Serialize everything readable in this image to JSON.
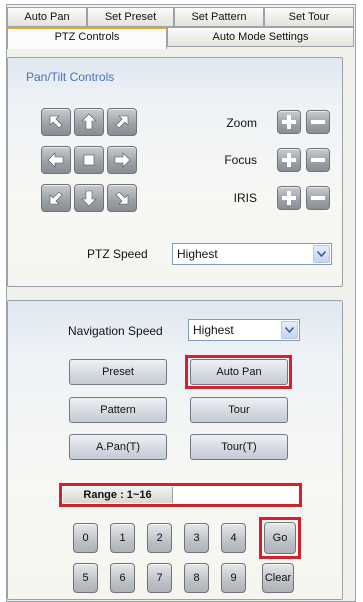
{
  "tabs_row1": [
    {
      "label": "Auto Pan"
    },
    {
      "label": "Set Preset"
    },
    {
      "label": "Set Pattern"
    },
    {
      "label": "Set Tour"
    }
  ],
  "tabs_row2": [
    {
      "label": "PTZ Controls",
      "active": true
    },
    {
      "label": "Auto Mode Settings",
      "active": false
    }
  ],
  "pan_tilt": {
    "title": "Pan/Tilt Controls",
    "arrows": [
      "up-left",
      "up",
      "up-right",
      "left",
      "stop",
      "right",
      "down-left",
      "down",
      "down-right"
    ]
  },
  "lens": {
    "zoom_label": "Zoom",
    "focus_label": "Focus",
    "iris_label": "IRIS"
  },
  "ptz_speed": {
    "label": "PTZ Speed",
    "value": "Highest"
  },
  "navigation_speed": {
    "label": "Navigation Speed",
    "value": "Highest"
  },
  "mode_buttons": {
    "preset": "Preset",
    "auto_pan": "Auto Pan",
    "pattern": "Pattern",
    "tour": "Tour",
    "apan_t": "A.Pan(T)",
    "tour_t": "Tour(T)"
  },
  "range": {
    "label": "Range : 1~16",
    "value": ""
  },
  "keypad": {
    "row1": [
      "0",
      "1",
      "2",
      "3",
      "4"
    ],
    "row2": [
      "5",
      "6",
      "7",
      "8",
      "9"
    ],
    "go": "Go",
    "clear": "Clear"
  },
  "colors": {
    "highlight": "#d81f2a",
    "active_tab": "#f4a21b",
    "section_title": "#4672bd"
  }
}
